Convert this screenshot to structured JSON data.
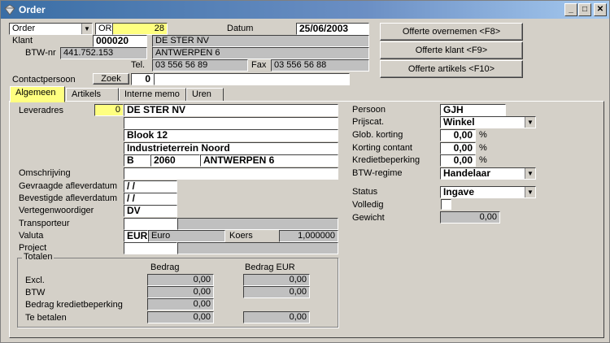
{
  "window": {
    "title": "Order"
  },
  "header": {
    "doc_type": "Order",
    "prefix": "OR",
    "number": "28",
    "datum_label": "Datum",
    "datum": "25/06/2003",
    "klant_label": "Klant",
    "klant_code": "000020",
    "klant_name": "DE STER NV",
    "btw_label": "BTW-nr",
    "btw_nr": "441.752.153",
    "city": "ANTWERPEN 6",
    "tel_label": "Tel.",
    "tel": "03 556 56 89",
    "fax_label": "Fax",
    "fax": "03 556 56 88",
    "contact_label": "Contactpersoon",
    "zoek_label": "Zoek",
    "contact_code": "0",
    "contact_name": ""
  },
  "actions": {
    "offerte_overnemen": "Offerte overnemen <F8>",
    "offerte_klant": "Offerte klant <F9>",
    "offerte_artikels": "Offerte artikels <F10>"
  },
  "tabs": [
    "Algemeen",
    "Artikels",
    "Interne memo",
    "Uren"
  ],
  "general": {
    "leveradres_label": "Leveradres",
    "leveradres_code": "0",
    "address_line1": "DE STER NV",
    "address_line2": "",
    "address_line3": "Blook 12",
    "address_line4": "Industrieterrein Noord",
    "country": "B",
    "postcode": "2060",
    "city": "ANTWERPEN 6",
    "omschrijving_label": "Omschrijving",
    "omschrijving": "",
    "gevraagde_label": "Gevraagde afleverdatum",
    "gevraagde": " /  /",
    "bevestigde_label": "Bevestigde afleverdatum",
    "bevestigde": " /  /",
    "vertegen_label": "Vertegenwoordiger",
    "vertegen": "DV",
    "transporteur_label": "Transporteur",
    "transporteur_code": "",
    "transporteur_name": "",
    "valuta_label": "Valuta",
    "valuta_code": "EUR",
    "valuta_name": "Euro",
    "koers_label": "Koers",
    "koers": "1,000000",
    "project_label": "Project",
    "project_code": "",
    "project_name": ""
  },
  "right": {
    "persoon_label": "Persoon",
    "persoon": "GJH",
    "prijscat_label": "Prijscat.",
    "prijscat": "Winkel",
    "glob_korting_label": "Glob. korting",
    "glob_korting": "0,00",
    "korting_contant_label": "Korting contant",
    "korting_contant": "0,00",
    "kredietbeperking_label": "Kredietbeperking",
    "kredietbeperking": "0,00",
    "btw_regime_label": "BTW-regime",
    "btw_regime": "Handelaar",
    "status_label": "Status",
    "status": "Ingave",
    "volledig_label": "Volledig",
    "gewicht_label": "Gewicht",
    "gewicht": "0,00",
    "pct": "%"
  },
  "totalen": {
    "title": "Totalen",
    "col_bedrag": "Bedrag",
    "col_bedrag_eur": "Bedrag EUR",
    "excl_label": "Excl.",
    "excl": "0,00",
    "excl_eur": "0,00",
    "btw_label": "BTW",
    "btw": "0,00",
    "btw_eur": "0,00",
    "krediet_label": "Bedrag kredietbeperking",
    "krediet": "0,00",
    "te_betalen_label": "Te betalen",
    "te_betalen": "0,00",
    "te_betalen_eur": "0,00"
  }
}
